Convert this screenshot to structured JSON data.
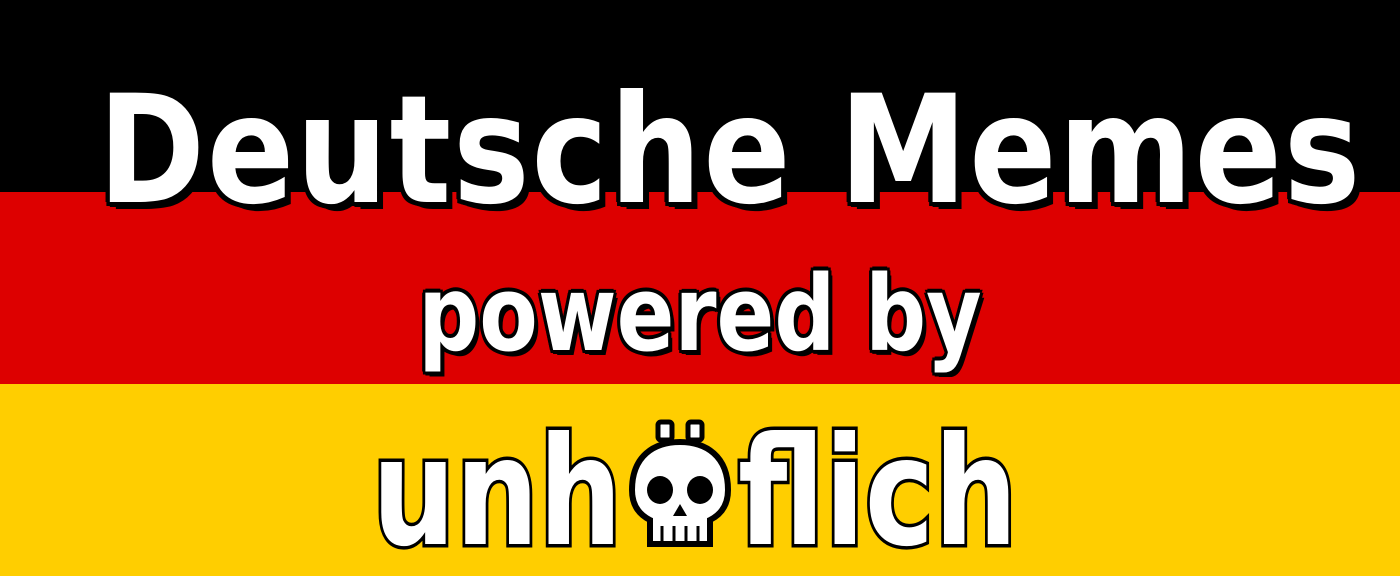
{
  "flag": {
    "colors": [
      "#000000",
      "#dd0000",
      "#ffce00"
    ]
  },
  "banner": {
    "title": "Deutsche Memes",
    "subtitle": "powered by",
    "logo_text": "unhöflich",
    "logo_icon": "skull-icon"
  }
}
